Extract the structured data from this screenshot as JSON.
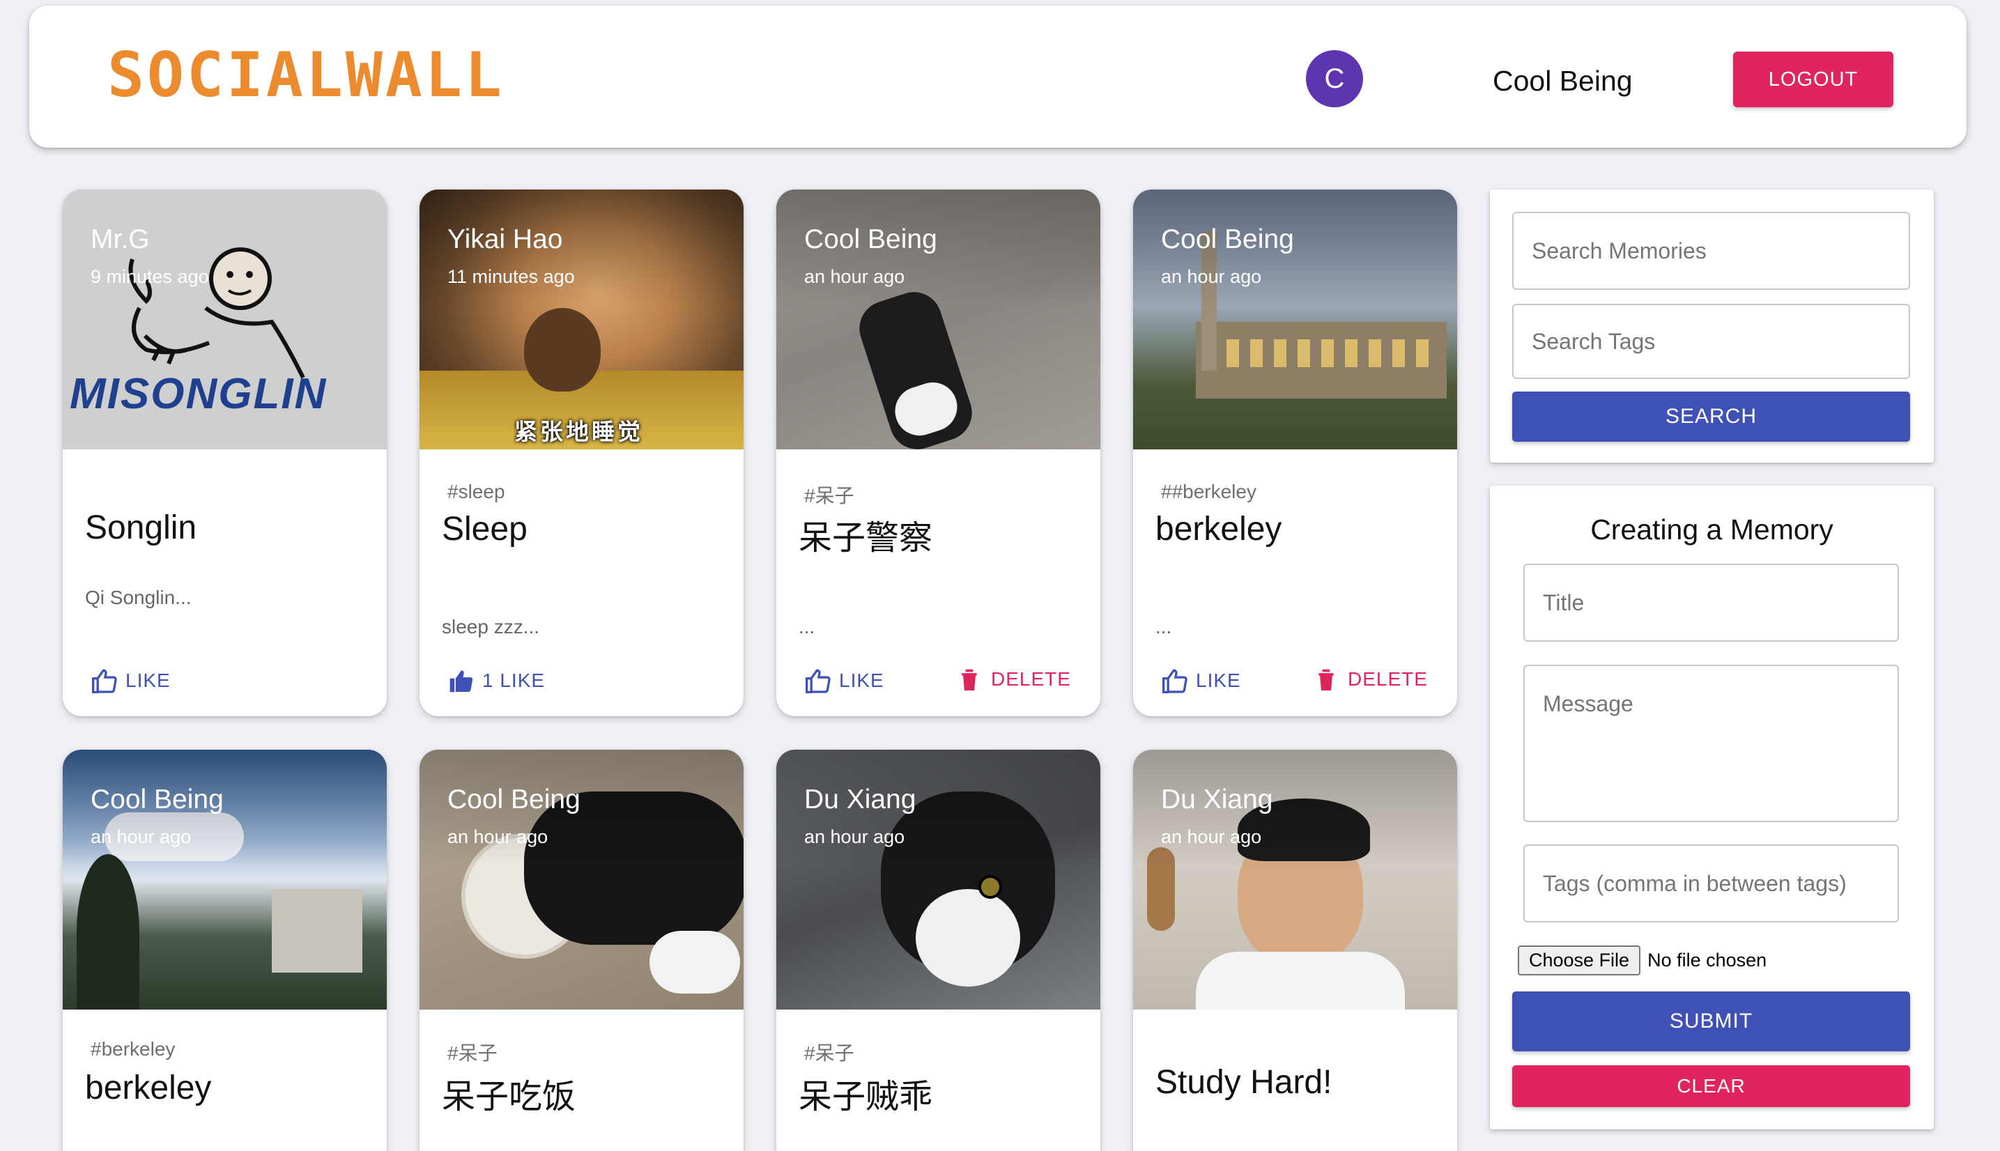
{
  "header": {
    "brand": "SOCIALWALL",
    "avatar_initial": "C",
    "username": "Cool Being",
    "logout_label": "LOGOUT"
  },
  "posts": [
    {
      "author": "Mr.G",
      "time": "9 minutes ago",
      "tags": "",
      "title": "Songlin",
      "message": "Qi Songlin...",
      "like_label": "LIKE",
      "image_text": "MISONGLIN"
    },
    {
      "author": "Yikai Hao",
      "time": "11 minutes ago",
      "tags": "#sleep",
      "title": "Sleep",
      "message": "sleep zzz...",
      "like_label": "1 LIKE",
      "image_text": "紧张地睡觉"
    },
    {
      "author": "Cool Being",
      "time": "an hour ago",
      "tags": "#呆子",
      "title": "呆子警察",
      "message": "...",
      "like_label": "LIKE",
      "delete_label": "DELETE"
    },
    {
      "author": "Cool Being",
      "time": "an hour ago",
      "tags": "##berkeley",
      "title": "berkeley",
      "message": "...",
      "like_label": "LIKE",
      "delete_label": "DELETE"
    },
    {
      "author": "Cool Being",
      "time": "an hour ago",
      "tags": "#berkeley",
      "title": "berkeley"
    },
    {
      "author": "Cool Being",
      "time": "an hour ago",
      "tags": "#呆子",
      "title": "呆子吃饭"
    },
    {
      "author": "Du Xiang",
      "time": "an hour ago",
      "tags": "#呆子",
      "title": "呆子贼乖"
    },
    {
      "author": "Du Xiang",
      "time": "an hour ago",
      "tags": "",
      "title": "Study Hard!"
    }
  ],
  "search": {
    "memories_placeholder": "Search Memories",
    "tags_placeholder": "Search Tags",
    "button_label": "SEARCH"
  },
  "form": {
    "heading": "Creating a Memory",
    "title_placeholder": "Title",
    "message_placeholder": "Message",
    "tags_placeholder": "Tags (comma in between tags)",
    "choose_file_label": "Choose File",
    "no_file_text": "No file chosen",
    "submit_label": "SUBMIT",
    "clear_label": "CLEAR"
  },
  "colors": {
    "brand": "#ec8a2e",
    "primary": "#3f51b5",
    "danger": "#e0245e",
    "avatar": "#5e35b1"
  }
}
